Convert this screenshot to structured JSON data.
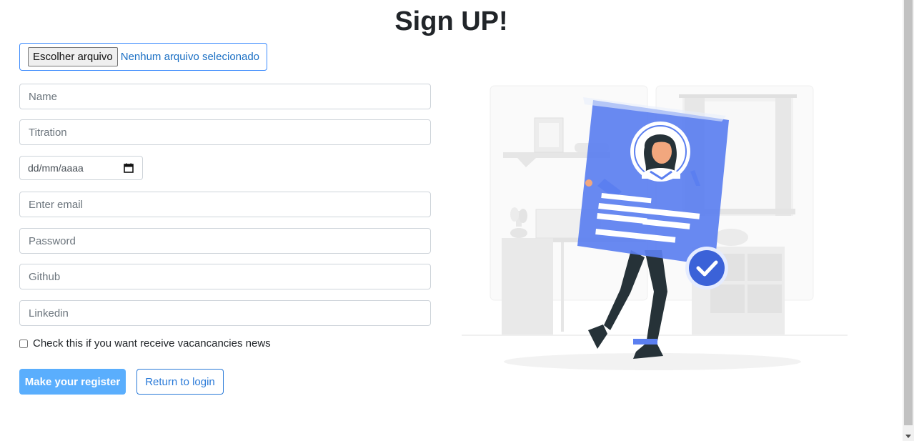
{
  "page": {
    "title": "Sign UP!"
  },
  "file_input": {
    "button_label": "Escolher arquivo",
    "status": "Nenhum arquivo selecionado"
  },
  "form": {
    "name_placeholder": "Name",
    "titration_placeholder": "Titration",
    "date_placeholder": "dd/mm/aaaa",
    "email_placeholder": "Enter email",
    "password_placeholder": "Password",
    "github_placeholder": "Github",
    "linkedin_placeholder": "Linkedin",
    "news_checkbox_label": "Check this if you want receive vacancancies news",
    "news_checkbox_checked": false
  },
  "actions": {
    "register_label": "Make your register",
    "login_label": "Return to login"
  },
  "colors": {
    "primary": "#5aaefd",
    "outline": "#2a7ad8",
    "illustration_accent": "#5b7ff0"
  },
  "icons": {
    "date": "calendar-icon",
    "illustration_badge": "checkmark-icon"
  }
}
